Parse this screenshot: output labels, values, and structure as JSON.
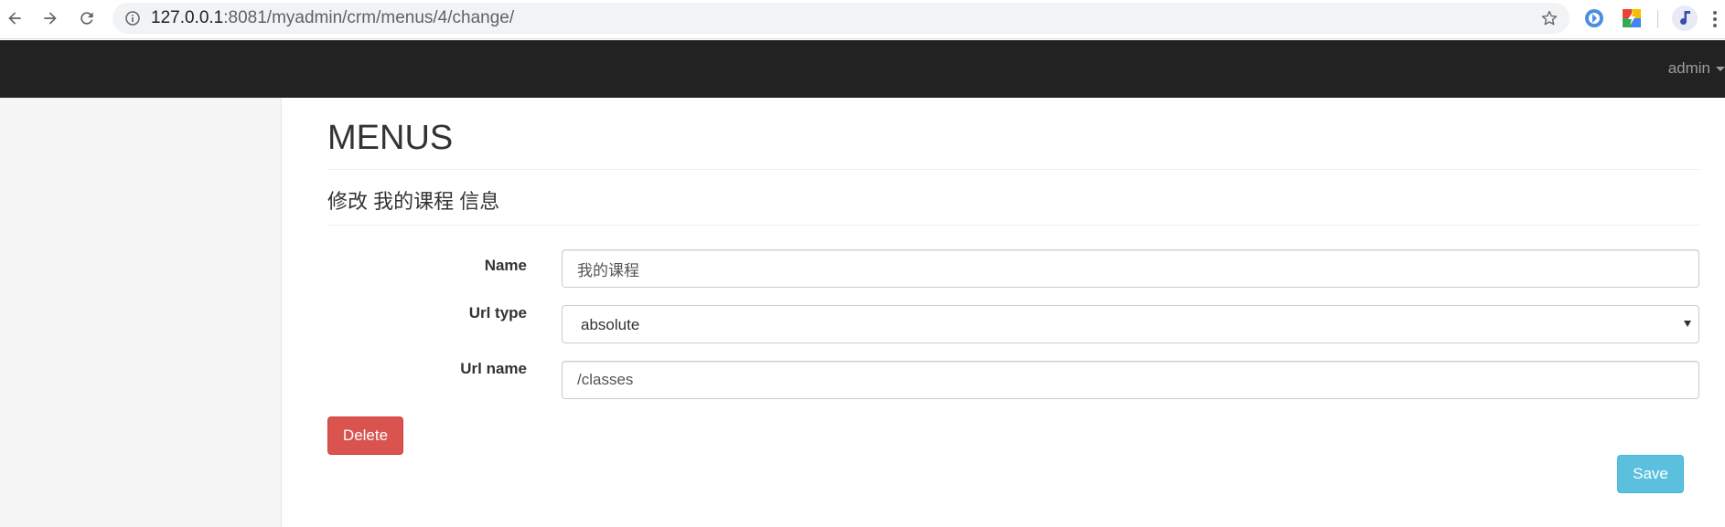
{
  "browser": {
    "url_host": "127.0.0.1",
    "url_rest": ":8081/myadmin/crm/menus/4/change/",
    "extensions": [
      "extension-blue-icon",
      "extension-colorful-icon",
      "extension-music-icon"
    ]
  },
  "navbar": {
    "user": "admin"
  },
  "page": {
    "title": "MENUS",
    "subtitle": "修改 我的课程 信息"
  },
  "form": {
    "name_label": "Name",
    "name_value": "我的课程",
    "url_type_label": "Url type",
    "url_type_value": "absolute",
    "url_name_label": "Url name",
    "url_name_value": "/classes"
  },
  "actions": {
    "delete_label": "Delete",
    "save_label": "Save"
  },
  "colors": {
    "navbar_bg": "#222222",
    "delete_btn": "#d9534f",
    "save_btn": "#5bc0de",
    "sidebar_bg": "#f5f5f5"
  }
}
